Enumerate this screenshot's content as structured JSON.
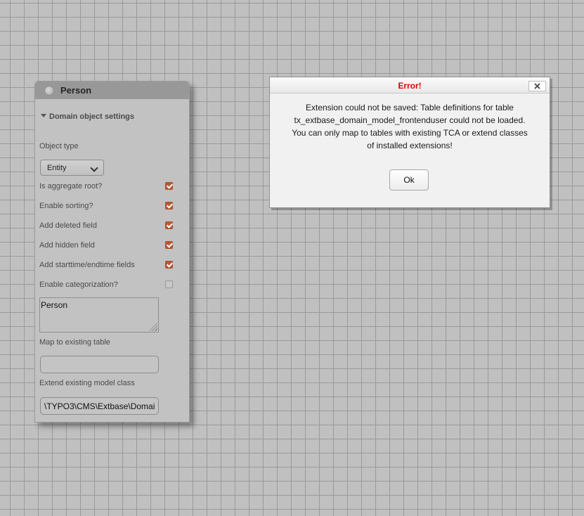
{
  "entity": {
    "title": "Person",
    "section_label": "Domain object settings",
    "object_type_label": "Object type",
    "object_type_value": "Entity",
    "checkboxes": [
      {
        "label": "Is aggregate root?",
        "checked": true
      },
      {
        "label": "Enable sorting?",
        "checked": true
      },
      {
        "label": "Add deleted field",
        "checked": true
      },
      {
        "label": "Add hidden field",
        "checked": true
      },
      {
        "label": "Add starttime/endtime fields",
        "checked": true
      },
      {
        "label": "Enable categorization?",
        "checked": false
      }
    ],
    "description_value": "Person",
    "map_table_label": "Map to existing table",
    "map_table_value": "",
    "extend_class_label": "Extend existing model class",
    "extend_class_value": "\\TYPO3\\CMS\\Extbase\\Domai"
  },
  "dialog": {
    "title": "Error!",
    "message_lines": [
      "Extension could not be saved: Table definitions for table",
      "tx_extbase_domain_model_frontenduser could not be loaded.",
      "You can only map to tables with existing TCA or extend classes",
      "of installed extensions!"
    ],
    "ok_label": "Ok",
    "close_icon": "close-icon"
  },
  "colors": {
    "error_title": "#e00000",
    "checkbox_checked": "#b85a35",
    "canvas_bg": "#c0c0c0",
    "grid_line": "#9a9a9a"
  }
}
